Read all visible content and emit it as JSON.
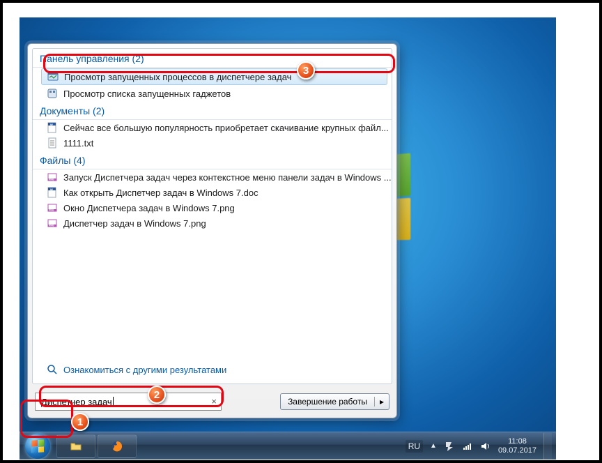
{
  "groups": {
    "control_panel": {
      "title": "Панель управления (2)",
      "items": [
        {
          "icon": "tm-icon",
          "label": "Просмотр запущенных процессов в диспетчере задач",
          "selected": true
        },
        {
          "icon": "gadget-icon",
          "label": "Просмотр списка запущенных гаджетов"
        }
      ]
    },
    "documents": {
      "title": "Документы (2)",
      "items": [
        {
          "icon": "word-icon",
          "label": "Сейчас все большую популярность приобретает скачивание крупных файл..."
        },
        {
          "icon": "txt-icon",
          "label": "1111.txt"
        }
      ]
    },
    "files": {
      "title": "Файлы (4)",
      "items": [
        {
          "icon": "png-icon",
          "label": "Запуск Диспетчера задач через контекстное меню панели задач в Windows ..."
        },
        {
          "icon": "word-icon",
          "label": "Как открыть Диспетчер задач в Windows 7.doc"
        },
        {
          "icon": "png-icon",
          "label": "Окно Диспетчера задач в Windows 7.png"
        },
        {
          "icon": "png-icon",
          "label": "Диспетчер задач в Windows 7.png"
        }
      ]
    }
  },
  "see_more": "Ознакомиться с другими результатами",
  "search_value": "Диспетчер задач",
  "shutdown_label": "Завершение работы",
  "tray": {
    "lang": "RU",
    "time": "11:08",
    "date": "09.07.2017"
  },
  "badges": {
    "b1": "1",
    "b2": "2",
    "b3": "3"
  }
}
